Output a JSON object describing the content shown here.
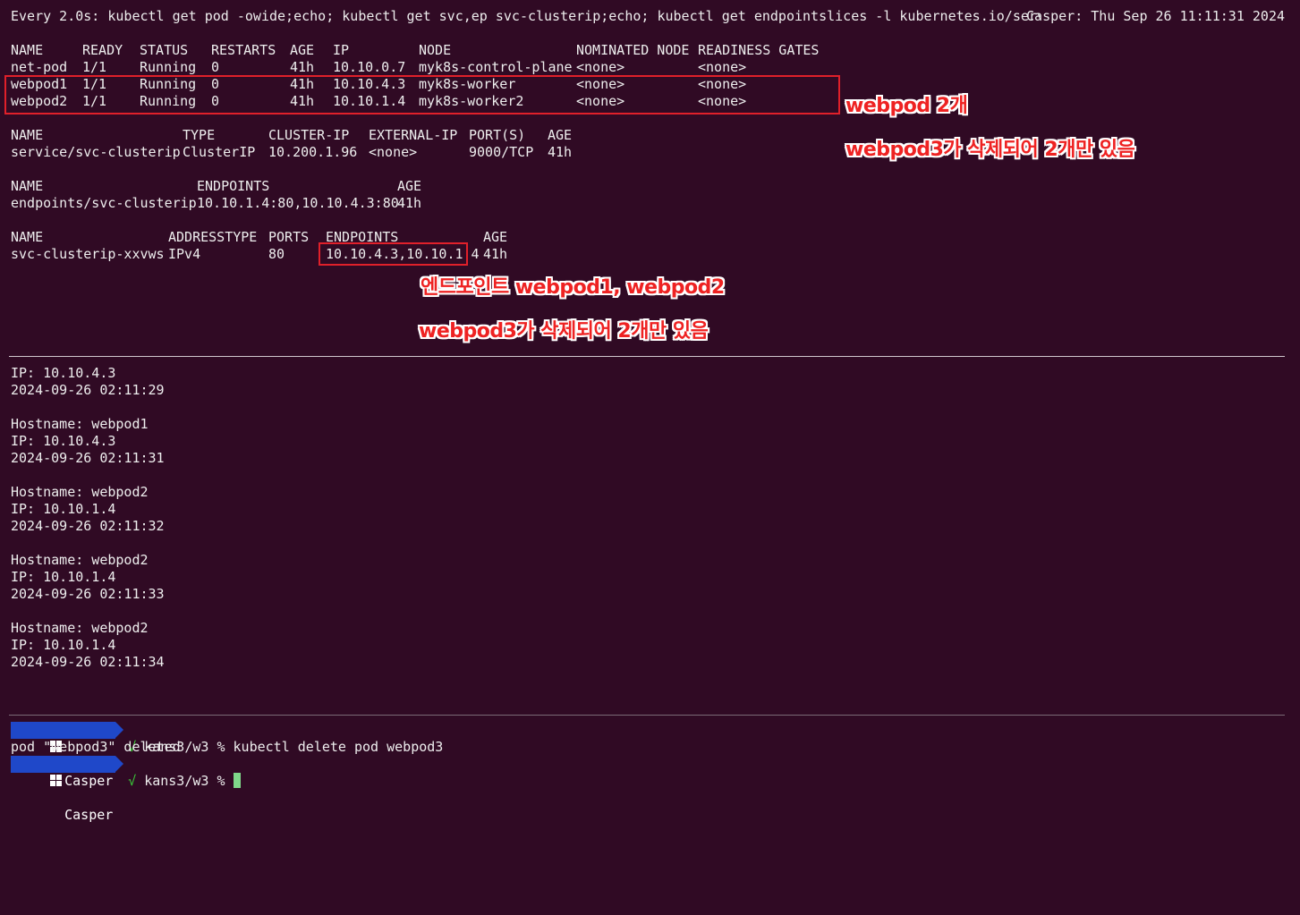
{
  "header": {
    "command": "Every 2.0s: kubectl get pod -owide;echo; kubectl get svc,ep svc-clusterip;echo; kubectl get endpointslices -l kubernetes.io/service-name=svc-...",
    "host_time": "Casper: Thu Sep 26 11:11:31 2024"
  },
  "pods": {
    "headers": [
      "NAME",
      "READY",
      "STATUS",
      "RESTARTS",
      "AGE",
      "IP",
      "NODE",
      "NOMINATED NODE",
      "READINESS GATES"
    ],
    "rows": [
      [
        "net-pod",
        "1/1",
        "Running",
        "0",
        "41h",
        "10.10.0.7",
        "myk8s-control-plane",
        "<none>",
        "<none>"
      ],
      [
        "webpod1",
        "1/1",
        "Running",
        "0",
        "41h",
        "10.10.4.3",
        "myk8s-worker",
        "<none>",
        "<none>"
      ],
      [
        "webpod2",
        "1/1",
        "Running",
        "0",
        "41h",
        "10.10.1.4",
        "myk8s-worker2",
        "<none>",
        "<none>"
      ]
    ]
  },
  "svc": {
    "headers": [
      "NAME",
      "TYPE",
      "CLUSTER-IP",
      "EXTERNAL-IP",
      "PORT(S)",
      "AGE"
    ],
    "rows": [
      [
        "service/svc-clusterip",
        "ClusterIP",
        "10.200.1.96",
        "<none>",
        "9000/TCP",
        "41h"
      ]
    ]
  },
  "ep": {
    "headers": [
      "NAME",
      "ENDPOINTS",
      "AGE"
    ],
    "rows": [
      [
        "endpoints/svc-clusterip",
        "10.10.1.4:80,10.10.4.3:80",
        "41h"
      ]
    ]
  },
  "eps": {
    "headers": [
      "NAME",
      "ADDRESSTYPE",
      "PORTS",
      "ENDPOINTS",
      "AGE"
    ],
    "rows": [
      [
        "svc-clusterip-xxvws",
        "IPv4",
        "80",
        "10.10.4.3,10.10.1.4",
        "41h"
      ]
    ]
  },
  "annotations": {
    "pods_count": "webpod 2개",
    "pods_deleted": "webpod3가 삭제되어 2개만 있음",
    "eps_list": "엔드포인트 webpod1, webpod2",
    "eps_deleted": "webpod3가 삭제되어 2개만 있음"
  },
  "curl_log": [
    "IP: 10.10.4.3",
    "2024-09-26 02:11:29",
    "",
    "Hostname: webpod1",
    "IP: 10.10.4.3",
    "2024-09-26 02:11:31",
    "",
    "Hostname: webpod2",
    "IP: 10.10.1.4",
    "2024-09-26 02:11:32",
    "",
    "Hostname: webpod2",
    "IP: 10.10.1.4",
    "2024-09-26 02:11:33",
    "",
    "Hostname: webpod2",
    "IP: 10.10.1.4",
    "2024-09-26 02:11:34"
  ],
  "shell": {
    "badge": "Casper",
    "check": "√",
    "prompt": "kans3/w3 %",
    "command": "kubectl delete pod webpod3",
    "output": "pod \"webpod3\" deleted"
  },
  "colors": {
    "background": "#300a24",
    "annotation": "#ee2222",
    "badge": "#1f48c9",
    "cursor": "#7fd88a"
  }
}
